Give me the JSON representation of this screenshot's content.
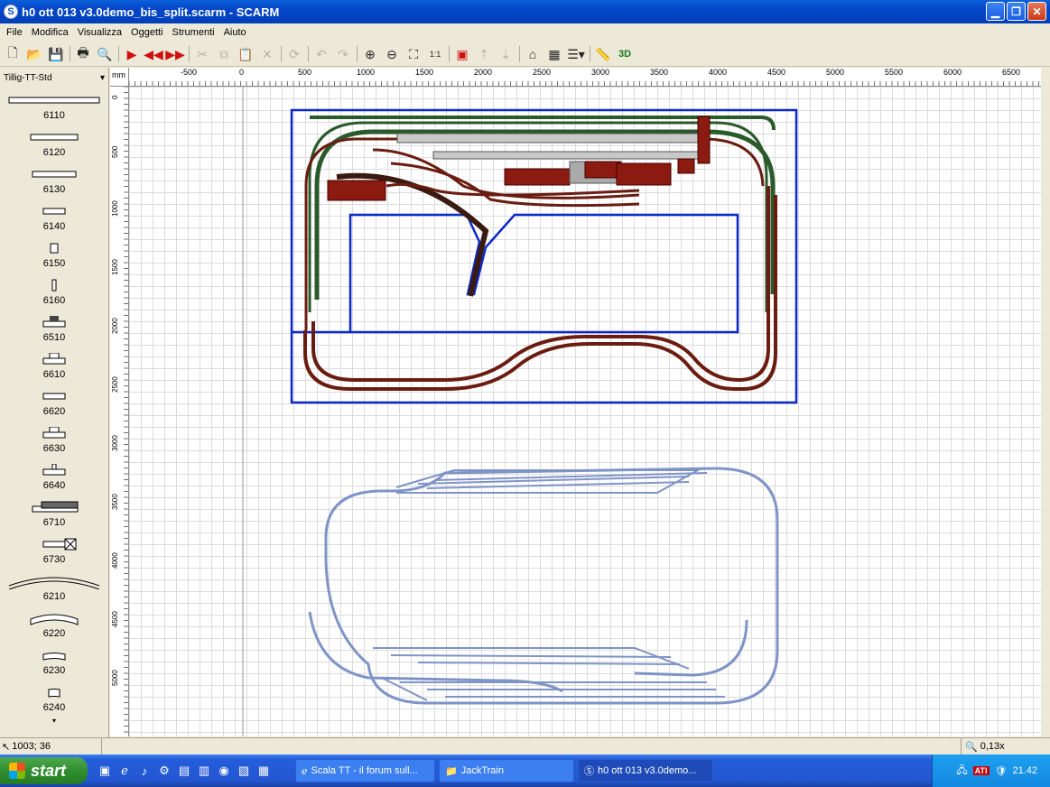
{
  "window": {
    "title": "h0 ott 013 v3.0demo_bis_split.scarm - SCARM",
    "app_icon": "S"
  },
  "menu": [
    "File",
    "Modifica",
    "Visualizza",
    "Oggetti",
    "Strumenti",
    "Aiuto"
  ],
  "toolbar": [
    {
      "icon": "new-icon",
      "glyph": "🗋",
      "enabled": true
    },
    {
      "icon": "open-icon",
      "glyph": "📂",
      "enabled": true
    },
    {
      "icon": "save-icon",
      "glyph": "💾",
      "enabled": true
    },
    {
      "icon": "sep"
    },
    {
      "icon": "print-icon",
      "glyph": "🖶",
      "enabled": true
    },
    {
      "icon": "print-preview-icon",
      "glyph": "🔍",
      "enabled": true
    },
    {
      "icon": "sep"
    },
    {
      "icon": "track-end-icon",
      "glyph": "▶",
      "enabled": true,
      "red": true
    },
    {
      "icon": "track-back-icon",
      "glyph": "◀◀",
      "enabled": true,
      "red": true
    },
    {
      "icon": "track-forward-icon",
      "glyph": "▶▶",
      "enabled": true,
      "red": true
    },
    {
      "icon": "sep"
    },
    {
      "icon": "cut-icon",
      "glyph": "✂",
      "enabled": false
    },
    {
      "icon": "copy-icon",
      "glyph": "⧉",
      "enabled": false
    },
    {
      "icon": "paste-icon",
      "glyph": "📋",
      "enabled": false
    },
    {
      "icon": "delete-icon",
      "glyph": "✕",
      "enabled": false
    },
    {
      "icon": "sep"
    },
    {
      "icon": "rotate-icon",
      "glyph": "⟳",
      "enabled": false
    },
    {
      "icon": "sep"
    },
    {
      "icon": "undo-icon",
      "glyph": "↶",
      "enabled": false
    },
    {
      "icon": "redo-icon",
      "glyph": "↷",
      "enabled": false
    },
    {
      "icon": "sep"
    },
    {
      "icon": "zoom-in-icon",
      "glyph": "⊕",
      "enabled": true
    },
    {
      "icon": "zoom-out-icon",
      "glyph": "⊖",
      "enabled": true
    },
    {
      "icon": "zoom-fit-icon",
      "glyph": "⛶",
      "enabled": true
    },
    {
      "icon": "zoom-1to1-icon",
      "glyph": "1:1",
      "enabled": true
    },
    {
      "icon": "sep"
    },
    {
      "icon": "layer-icon",
      "glyph": "▣",
      "enabled": true,
      "red": true
    },
    {
      "icon": "height-up-icon",
      "glyph": "⇡",
      "enabled": false
    },
    {
      "icon": "height-down-icon",
      "glyph": "⇣",
      "enabled": false
    },
    {
      "icon": "sep"
    },
    {
      "icon": "bridge-icon",
      "glyph": "⌂",
      "enabled": true
    },
    {
      "icon": "object-icon",
      "glyph": "▦",
      "enabled": true
    },
    {
      "icon": "layers-menu-icon",
      "glyph": "☰▾",
      "enabled": true
    },
    {
      "icon": "sep"
    },
    {
      "icon": "measure-icon",
      "glyph": "📏",
      "enabled": true
    },
    {
      "icon": "view-3d-icon",
      "glyph": "3D",
      "enabled": true
    }
  ],
  "library": {
    "selected": "Tillig-TT-Std",
    "items": [
      {
        "label": "6110",
        "shape": "straight-long"
      },
      {
        "label": "6120",
        "shape": "straight-med"
      },
      {
        "label": "6130",
        "shape": "straight-med2"
      },
      {
        "label": "6140",
        "shape": "straight-short"
      },
      {
        "label": "6150",
        "shape": "straight-tiny"
      },
      {
        "label": "6160",
        "shape": "straight-mini"
      },
      {
        "label": "6510",
        "shape": "uncoupler"
      },
      {
        "label": "6610",
        "shape": "signal-track"
      },
      {
        "label": "6620",
        "shape": "straight-short"
      },
      {
        "label": "6630",
        "shape": "signal-track"
      },
      {
        "label": "6640",
        "shape": "contact-track"
      },
      {
        "label": "6710",
        "shape": "crossing"
      },
      {
        "label": "6730",
        "shape": "buffer"
      },
      {
        "label": "6210",
        "shape": "curve-large"
      },
      {
        "label": "6220",
        "shape": "curve-med"
      },
      {
        "label": "6230",
        "shape": "curve-short"
      },
      {
        "label": "6240",
        "shape": "curve-tiny"
      }
    ]
  },
  "ruler": {
    "unit": "mm",
    "x_labels": [
      "-500",
      "0",
      "500",
      "1000",
      "1500",
      "2000",
      "2500",
      "3000",
      "3500",
      "4000",
      "4500",
      "5000",
      "5500",
      "6000",
      "6500"
    ],
    "y_labels": [
      "0",
      "500",
      "1000",
      "1500",
      "2000",
      "2500",
      "3000",
      "3500",
      "4000",
      "4500",
      "5000"
    ]
  },
  "status": {
    "coordinates": "1003; 36",
    "zoom": "0,13x"
  },
  "colors": {
    "board_outline": "#0a27c8",
    "track_green": "#2a5a2a",
    "track_brown": "#6a1c10",
    "track_blue": "#7f94c6",
    "building": "#8b1a10"
  },
  "taskbar": {
    "start_label": "start",
    "tasks": [
      {
        "label": "Scala TT - il forum sull...",
        "icon": "ie-icon",
        "active": false
      },
      {
        "label": "JackTrain",
        "icon": "folder-icon",
        "active": false
      },
      {
        "label": "h0 ott 013 v3.0demo...",
        "icon": "scarm-icon",
        "active": true
      }
    ],
    "tray_text": "ATI",
    "clock": "21.42"
  }
}
